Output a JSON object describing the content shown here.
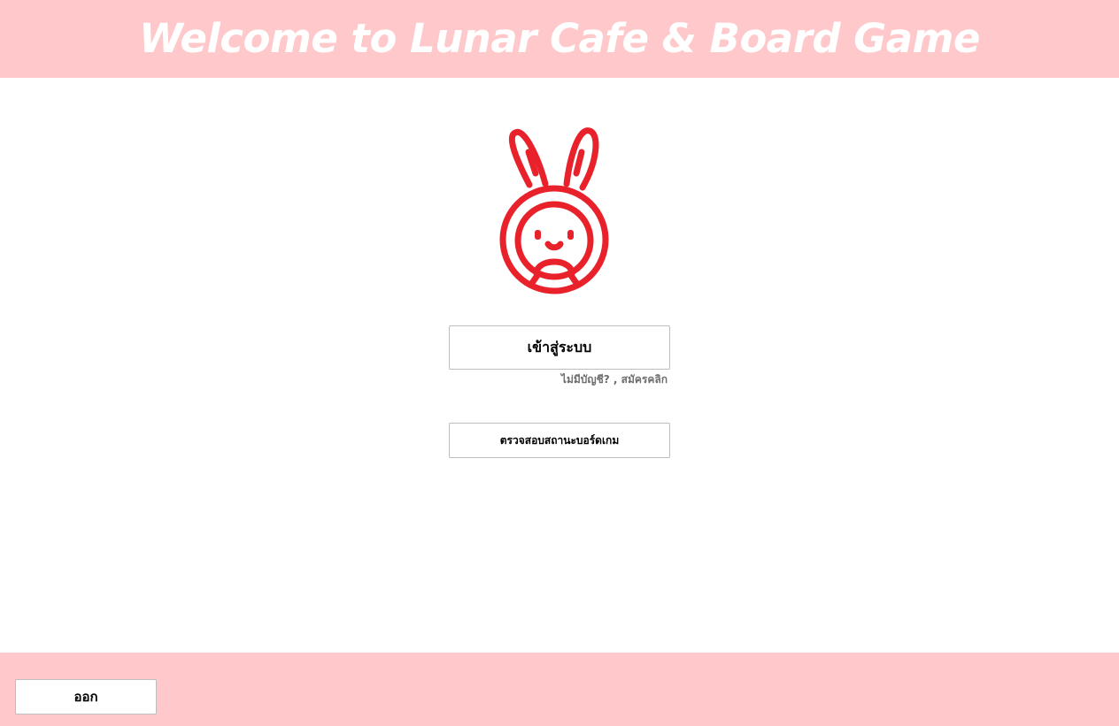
{
  "header": {
    "title": "Welcome to Lunar Cafe & Board Game"
  },
  "logo": {
    "icon": "bunny-logo-icon",
    "color": "#e8212b"
  },
  "main": {
    "login_label": "เข้าสู่ระบบ",
    "signup_text": "ไม่มีบัญชี? , สมัครคลิก",
    "status_label": "ตรวจสอบสถานะบอร์ดเกม"
  },
  "footer": {
    "exit_label": "ออก"
  },
  "colors": {
    "banner": "#ffc9cb",
    "logo": "#e8212b",
    "text_muted": "#6e6e6e"
  }
}
